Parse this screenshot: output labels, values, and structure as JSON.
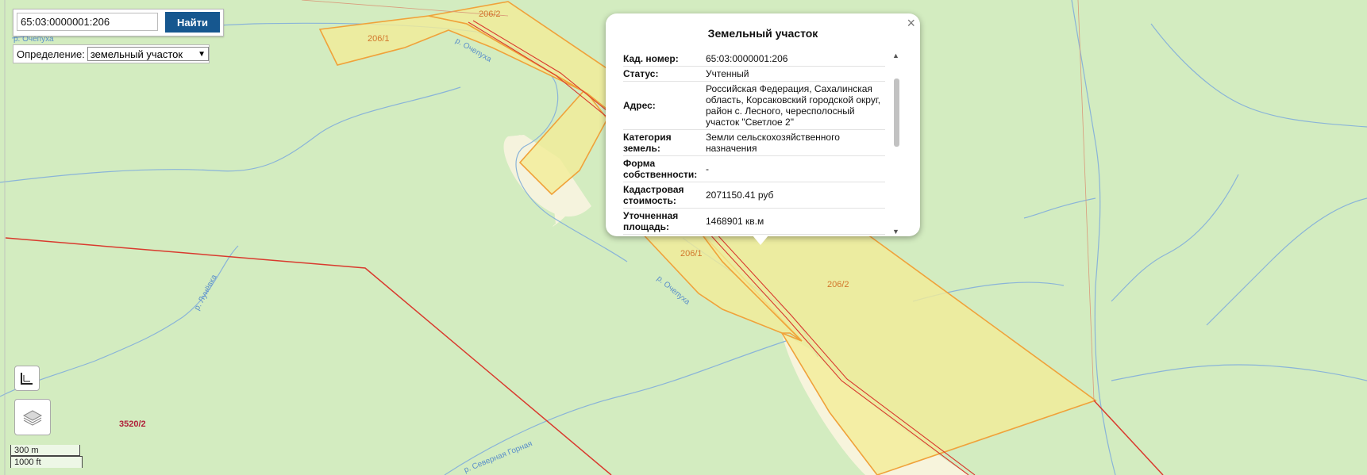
{
  "search": {
    "value": "65:03:0000001:206",
    "button_label": "Найти"
  },
  "definition": {
    "label": "Определение:",
    "selected": "земельный участок"
  },
  "popup": {
    "title": "Земельный участок",
    "close_label": "×",
    "rows": [
      {
        "key": "Кад. номер:",
        "value": "65:03:0000001:206"
      },
      {
        "key": "Статус:",
        "value": "Учтенный"
      },
      {
        "key": "Адрес:",
        "value": "Российская Федерация, Сахалинская область, Корсаковский городской округ, район с. Лесного, чересполосный участок \"Светлое 2\""
      },
      {
        "key": "Категория земель:",
        "value": "Земли сельскохозяйственного назначения"
      },
      {
        "key": "Форма собственности:",
        "value": "-"
      },
      {
        "key": "Кадастровая стоимость:",
        "value": "2071150.41 руб"
      },
      {
        "key": "Уточненная площадь:",
        "value": "1468901 кв.м"
      }
    ]
  },
  "map": {
    "parcel_labels": [
      "206/2",
      "206/1",
      "206/1",
      "206/2"
    ],
    "river_labels": [
      "р. Очепуха",
      "р. Очепуха",
      "р. Лунёвка",
      "р. Северная Горная",
      "р. Очепуха"
    ],
    "quarter_label": "3520/2",
    "colors": {
      "background": "#d3ecc0",
      "parcel_fill": "#f3ec97",
      "parcel_stroke": "#f0a23a",
      "boundary": "#d93a2e",
      "river": "#8ab4d8",
      "clearing": "#f7f4dc"
    }
  },
  "scale": {
    "metric": "300 m",
    "imperial": "1000 ft"
  }
}
